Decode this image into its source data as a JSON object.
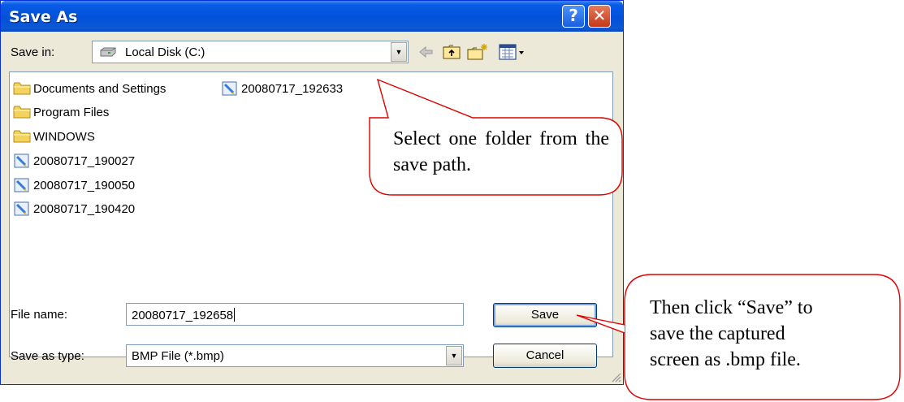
{
  "dialog": {
    "title": "Save As",
    "help_glyph": "?",
    "close_glyph": "✕"
  },
  "toolbar": {
    "save_in_label": "Save in:",
    "location": "Local Disk (C:)",
    "icons": [
      "drive-icon",
      "back-arrow-icon",
      "up-folder-icon",
      "new-folder-icon",
      "views-menu-icon"
    ]
  },
  "files": [
    {
      "name": "Documents and Settings",
      "type": "folder"
    },
    {
      "name": "Program Files",
      "type": "folder"
    },
    {
      "name": "WINDOWS",
      "type": "folder"
    },
    {
      "name": "20080717_190027",
      "type": "image"
    },
    {
      "name": "20080717_190050",
      "type": "image"
    },
    {
      "name": "20080717_190420",
      "type": "image"
    },
    {
      "name": "20080717_192633",
      "type": "image"
    }
  ],
  "form": {
    "file_name_label": "File name:",
    "file_name_value": "20080717_192658",
    "save_as_type_label": "Save as type:",
    "save_as_type_value": "BMP File  (*.bmp)"
  },
  "buttons": {
    "save": "Save",
    "cancel": "Cancel"
  },
  "callouts": {
    "folder_hint": "Select one folder from the save path.",
    "save_hint_line1": "Then click “Save” to",
    "save_hint_line2": "save the captured",
    "save_hint_line3": "screen as .bmp file."
  },
  "colors": {
    "title_bar": "#0150d8",
    "window_face": "#ece9d8",
    "callout_border": "#e00000"
  }
}
